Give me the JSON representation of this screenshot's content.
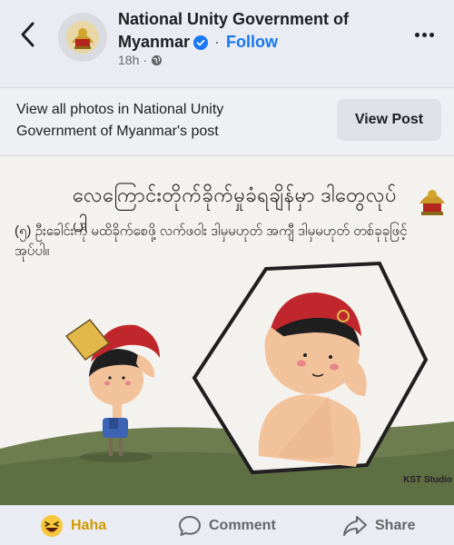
{
  "header": {
    "page_name_line1": "National Unity Government of",
    "page_name_line2": "Myanmar",
    "separator": " · ",
    "follow_label": "Follow",
    "timestamp": "18h",
    "meta_separator": "·",
    "audience_icon": "globe-icon"
  },
  "banner": {
    "text": "View all photos in National Unity Government of Myanmar's post",
    "button_label": "View Post"
  },
  "post_image": {
    "title": "လေကြောင်းတိုက်ခိုက်မှုခံရချိန်မှာ ဒါတွေလုပ်ပါ",
    "body": "(၅) ဦးခေါင်းကို မထိခိုက်စေဖို့ လက်ဖဝါး ဒါမှမဟုတ် အကျီ ဒါမှမဟုတ် တစ်ခုခုဖြင့် အုပ်ပါ။",
    "kst_logo": "KST Studio",
    "colors": {
      "sky": "#f4f2ee",
      "grass": "#6d7d4f",
      "helmet_red": "#c0272d",
      "skin": "#f2c29b"
    }
  },
  "actions": {
    "haha_label": "Haha",
    "comment_label": "Comment",
    "share_label": "Share"
  },
  "colors": {
    "accent": "#1877f2",
    "text_primary": "#1c1e21",
    "text_secondary": "#65676b"
  }
}
